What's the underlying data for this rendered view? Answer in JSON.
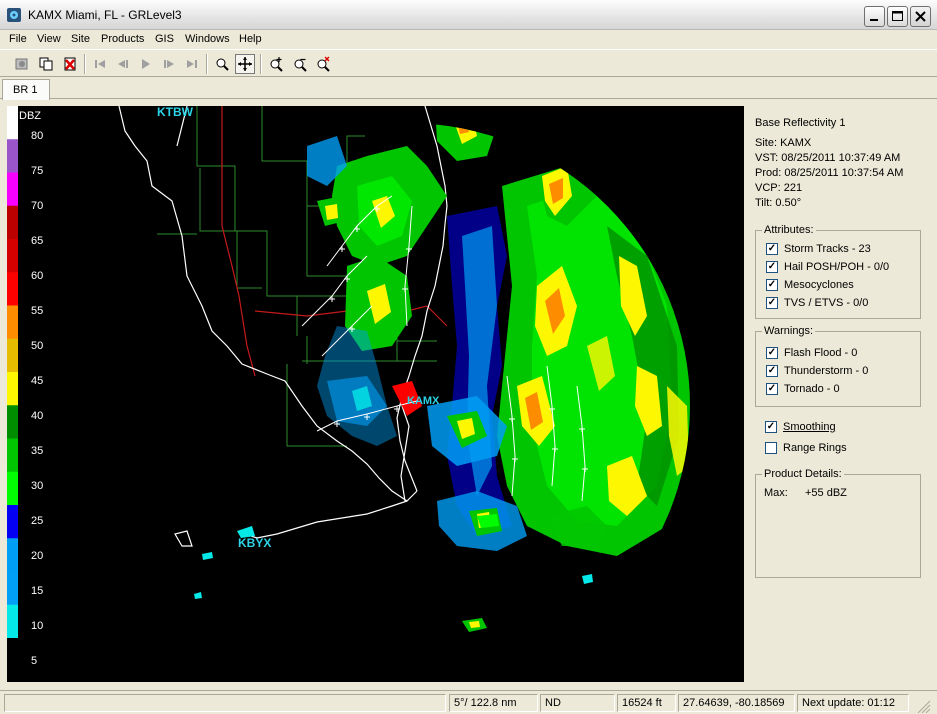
{
  "window": {
    "title": "KAMX Miami, FL - GRLevel3",
    "minimize_icon": "minimize-icon",
    "maximize_icon": "maximize-icon",
    "close_icon": "close-icon"
  },
  "menu": [
    "File",
    "View",
    "Site",
    "Products",
    "GIS",
    "Windows",
    "Help"
  ],
  "toolbar": {
    "icons": [
      "copy-image-icon",
      "duplicate-icon",
      "delete-icon",
      "first-frame-icon",
      "prev-frame-icon",
      "play-icon",
      "next-frame-icon",
      "last-frame-icon",
      "zoom-icon",
      "pan-icon",
      "zoom-in-icon",
      "zoom-out-icon",
      "zoom-reset-icon"
    ]
  },
  "tabs": [
    "BR 1"
  ],
  "map": {
    "legend_title": "DBZ",
    "legend_labels": [
      "80",
      "75",
      "70",
      "65",
      "60",
      "55",
      "50",
      "45",
      "40",
      "35",
      "30",
      "25",
      "20",
      "15",
      "10",
      "5"
    ],
    "legend_colors": [
      "#ffffff",
      "#9955c9",
      "#f800fd",
      "#bc0000",
      "#d40000",
      "#fd0000",
      "#fd8c00",
      "#e5bc00",
      "#fdf802",
      "#008e00",
      "#01c501",
      "#02fd02",
      "#0300f4",
      "#009ef4",
      "#01a0f6",
      "#04e9e7"
    ],
    "sites": [
      "KTBW",
      "KAMX",
      "KBYX"
    ]
  },
  "panel": {
    "product": "Base Reflectivity 1",
    "site": "Site:  KAMX",
    "vst": "VST:  08/25/2011   10:37:49 AM",
    "prod": "Prod:  08/25/2011   10:37:54 AM",
    "vcp": "VCP:  221",
    "tilt": "Tilt:   0.50°",
    "attributes_title": "Attributes:",
    "attributes": [
      {
        "label": "Storm Tracks - 23",
        "checked": true
      },
      {
        "label": "Hail POSH/POH - 0/0",
        "checked": true
      },
      {
        "label": "Mesocyclones",
        "checked": true
      },
      {
        "label": "TVS / ETVS - 0/0",
        "checked": true
      }
    ],
    "warnings_title": "Warnings:",
    "warnings": [
      {
        "label": "Flash Flood - 0",
        "checked": true
      },
      {
        "label": "Thunderstorm - 0",
        "checked": true
      },
      {
        "label": "Tornado - 0",
        "checked": true
      }
    ],
    "smoothing": {
      "label": "Smoothing",
      "checked": true
    },
    "range_rings": {
      "label": "Range Rings",
      "checked": false
    },
    "details_title": "Product Details:",
    "details_key": "Max:",
    "details_value": "+55 dBZ"
  },
  "status": {
    "blank": "",
    "bearing": "5°/ 122.8 nm",
    "nd": "ND",
    "altitude": "16524 ft",
    "coords": "27.64639, -80.18569",
    "next_update": "Next update: 01:12"
  }
}
